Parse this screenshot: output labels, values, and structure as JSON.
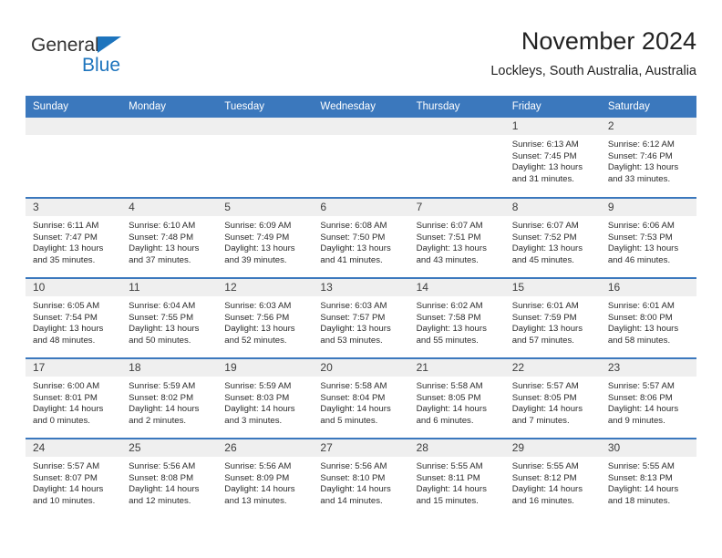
{
  "brand": {
    "name_top": "General",
    "name_bottom": "Blue",
    "triangle_color": "#1d74bd",
    "text_color": "#333333"
  },
  "header": {
    "title": "November 2024",
    "subtitle": "Lockleys, South Australia, Australia"
  },
  "theme": {
    "header_blue": "#3b78bd",
    "daynum_gray": "#efefef",
    "text": "#2b2b2b"
  },
  "labels": {
    "sunrise_prefix": "Sunrise:",
    "sunset_prefix": "Sunset:",
    "daylight_prefix": "Daylight:"
  },
  "columns": [
    "Sunday",
    "Monday",
    "Tuesday",
    "Wednesday",
    "Thursday",
    "Friday",
    "Saturday"
  ],
  "weeks": [
    [
      {
        "day": "",
        "sunrise": "",
        "sunset": "",
        "daylight_a": "",
        "daylight_b": ""
      },
      {
        "day": "",
        "sunrise": "",
        "sunset": "",
        "daylight_a": "",
        "daylight_b": ""
      },
      {
        "day": "",
        "sunrise": "",
        "sunset": "",
        "daylight_a": "",
        "daylight_b": ""
      },
      {
        "day": "",
        "sunrise": "",
        "sunset": "",
        "daylight_a": "",
        "daylight_b": ""
      },
      {
        "day": "",
        "sunrise": "",
        "sunset": "",
        "daylight_a": "",
        "daylight_b": ""
      },
      {
        "day": "1",
        "sunrise": "Sunrise: 6:13 AM",
        "sunset": "Sunset: 7:45 PM",
        "daylight_a": "Daylight: 13 hours",
        "daylight_b": "and 31 minutes."
      },
      {
        "day": "2",
        "sunrise": "Sunrise: 6:12 AM",
        "sunset": "Sunset: 7:46 PM",
        "daylight_a": "Daylight: 13 hours",
        "daylight_b": "and 33 minutes."
      }
    ],
    [
      {
        "day": "3",
        "sunrise": "Sunrise: 6:11 AM",
        "sunset": "Sunset: 7:47 PM",
        "daylight_a": "Daylight: 13 hours",
        "daylight_b": "and 35 minutes."
      },
      {
        "day": "4",
        "sunrise": "Sunrise: 6:10 AM",
        "sunset": "Sunset: 7:48 PM",
        "daylight_a": "Daylight: 13 hours",
        "daylight_b": "and 37 minutes."
      },
      {
        "day": "5",
        "sunrise": "Sunrise: 6:09 AM",
        "sunset": "Sunset: 7:49 PM",
        "daylight_a": "Daylight: 13 hours",
        "daylight_b": "and 39 minutes."
      },
      {
        "day": "6",
        "sunrise": "Sunrise: 6:08 AM",
        "sunset": "Sunset: 7:50 PM",
        "daylight_a": "Daylight: 13 hours",
        "daylight_b": "and 41 minutes."
      },
      {
        "day": "7",
        "sunrise": "Sunrise: 6:07 AM",
        "sunset": "Sunset: 7:51 PM",
        "daylight_a": "Daylight: 13 hours",
        "daylight_b": "and 43 minutes."
      },
      {
        "day": "8",
        "sunrise": "Sunrise: 6:07 AM",
        "sunset": "Sunset: 7:52 PM",
        "daylight_a": "Daylight: 13 hours",
        "daylight_b": "and 45 minutes."
      },
      {
        "day": "9",
        "sunrise": "Sunrise: 6:06 AM",
        "sunset": "Sunset: 7:53 PM",
        "daylight_a": "Daylight: 13 hours",
        "daylight_b": "and 46 minutes."
      }
    ],
    [
      {
        "day": "10",
        "sunrise": "Sunrise: 6:05 AM",
        "sunset": "Sunset: 7:54 PM",
        "daylight_a": "Daylight: 13 hours",
        "daylight_b": "and 48 minutes."
      },
      {
        "day": "11",
        "sunrise": "Sunrise: 6:04 AM",
        "sunset": "Sunset: 7:55 PM",
        "daylight_a": "Daylight: 13 hours",
        "daylight_b": "and 50 minutes."
      },
      {
        "day": "12",
        "sunrise": "Sunrise: 6:03 AM",
        "sunset": "Sunset: 7:56 PM",
        "daylight_a": "Daylight: 13 hours",
        "daylight_b": "and 52 minutes."
      },
      {
        "day": "13",
        "sunrise": "Sunrise: 6:03 AM",
        "sunset": "Sunset: 7:57 PM",
        "daylight_a": "Daylight: 13 hours",
        "daylight_b": "and 53 minutes."
      },
      {
        "day": "14",
        "sunrise": "Sunrise: 6:02 AM",
        "sunset": "Sunset: 7:58 PM",
        "daylight_a": "Daylight: 13 hours",
        "daylight_b": "and 55 minutes."
      },
      {
        "day": "15",
        "sunrise": "Sunrise: 6:01 AM",
        "sunset": "Sunset: 7:59 PM",
        "daylight_a": "Daylight: 13 hours",
        "daylight_b": "and 57 minutes."
      },
      {
        "day": "16",
        "sunrise": "Sunrise: 6:01 AM",
        "sunset": "Sunset: 8:00 PM",
        "daylight_a": "Daylight: 13 hours",
        "daylight_b": "and 58 minutes."
      }
    ],
    [
      {
        "day": "17",
        "sunrise": "Sunrise: 6:00 AM",
        "sunset": "Sunset: 8:01 PM",
        "daylight_a": "Daylight: 14 hours",
        "daylight_b": "and 0 minutes."
      },
      {
        "day": "18",
        "sunrise": "Sunrise: 5:59 AM",
        "sunset": "Sunset: 8:02 PM",
        "daylight_a": "Daylight: 14 hours",
        "daylight_b": "and 2 minutes."
      },
      {
        "day": "19",
        "sunrise": "Sunrise: 5:59 AM",
        "sunset": "Sunset: 8:03 PM",
        "daylight_a": "Daylight: 14 hours",
        "daylight_b": "and 3 minutes."
      },
      {
        "day": "20",
        "sunrise": "Sunrise: 5:58 AM",
        "sunset": "Sunset: 8:04 PM",
        "daylight_a": "Daylight: 14 hours",
        "daylight_b": "and 5 minutes."
      },
      {
        "day": "21",
        "sunrise": "Sunrise: 5:58 AM",
        "sunset": "Sunset: 8:05 PM",
        "daylight_a": "Daylight: 14 hours",
        "daylight_b": "and 6 minutes."
      },
      {
        "day": "22",
        "sunrise": "Sunrise: 5:57 AM",
        "sunset": "Sunset: 8:05 PM",
        "daylight_a": "Daylight: 14 hours",
        "daylight_b": "and 7 minutes."
      },
      {
        "day": "23",
        "sunrise": "Sunrise: 5:57 AM",
        "sunset": "Sunset: 8:06 PM",
        "daylight_a": "Daylight: 14 hours",
        "daylight_b": "and 9 minutes."
      }
    ],
    [
      {
        "day": "24",
        "sunrise": "Sunrise: 5:57 AM",
        "sunset": "Sunset: 8:07 PM",
        "daylight_a": "Daylight: 14 hours",
        "daylight_b": "and 10 minutes."
      },
      {
        "day": "25",
        "sunrise": "Sunrise: 5:56 AM",
        "sunset": "Sunset: 8:08 PM",
        "daylight_a": "Daylight: 14 hours",
        "daylight_b": "and 12 minutes."
      },
      {
        "day": "26",
        "sunrise": "Sunrise: 5:56 AM",
        "sunset": "Sunset: 8:09 PM",
        "daylight_a": "Daylight: 14 hours",
        "daylight_b": "and 13 minutes."
      },
      {
        "day": "27",
        "sunrise": "Sunrise: 5:56 AM",
        "sunset": "Sunset: 8:10 PM",
        "daylight_a": "Daylight: 14 hours",
        "daylight_b": "and 14 minutes."
      },
      {
        "day": "28",
        "sunrise": "Sunrise: 5:55 AM",
        "sunset": "Sunset: 8:11 PM",
        "daylight_a": "Daylight: 14 hours",
        "daylight_b": "and 15 minutes."
      },
      {
        "day": "29",
        "sunrise": "Sunrise: 5:55 AM",
        "sunset": "Sunset: 8:12 PM",
        "daylight_a": "Daylight: 14 hours",
        "daylight_b": "and 16 minutes."
      },
      {
        "day": "30",
        "sunrise": "Sunrise: 5:55 AM",
        "sunset": "Sunset: 8:13 PM",
        "daylight_a": "Daylight: 14 hours",
        "daylight_b": "and 18 minutes."
      }
    ]
  ]
}
